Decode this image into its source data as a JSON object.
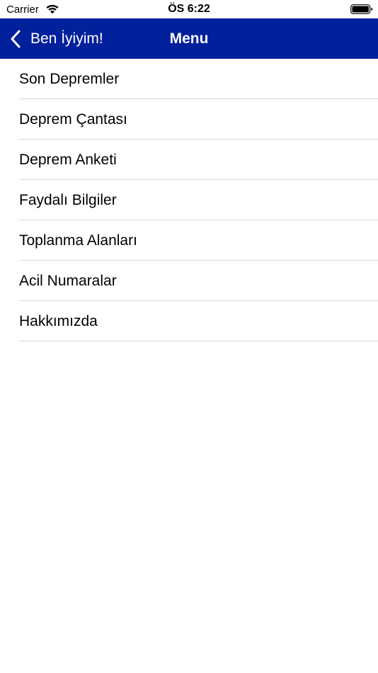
{
  "status_bar": {
    "carrier": "Carrier",
    "time": "ÖS 6:22",
    "wifi_icon": "wifi-icon",
    "battery_icon": "battery-icon"
  },
  "nav": {
    "back_label": "Ben İyiyim!",
    "title": "Menu",
    "background_color": "#00209c",
    "back_icon": "chevron-left-icon"
  },
  "menu": {
    "items": [
      {
        "label": "Son Depremler"
      },
      {
        "label": "Deprem Çantası"
      },
      {
        "label": "Deprem Anketi"
      },
      {
        "label": "Faydalı Bilgiler"
      },
      {
        "label": "Toplanma Alanları"
      },
      {
        "label": "Acil Numaralar"
      },
      {
        "label": "Hakkımızda"
      }
    ]
  }
}
